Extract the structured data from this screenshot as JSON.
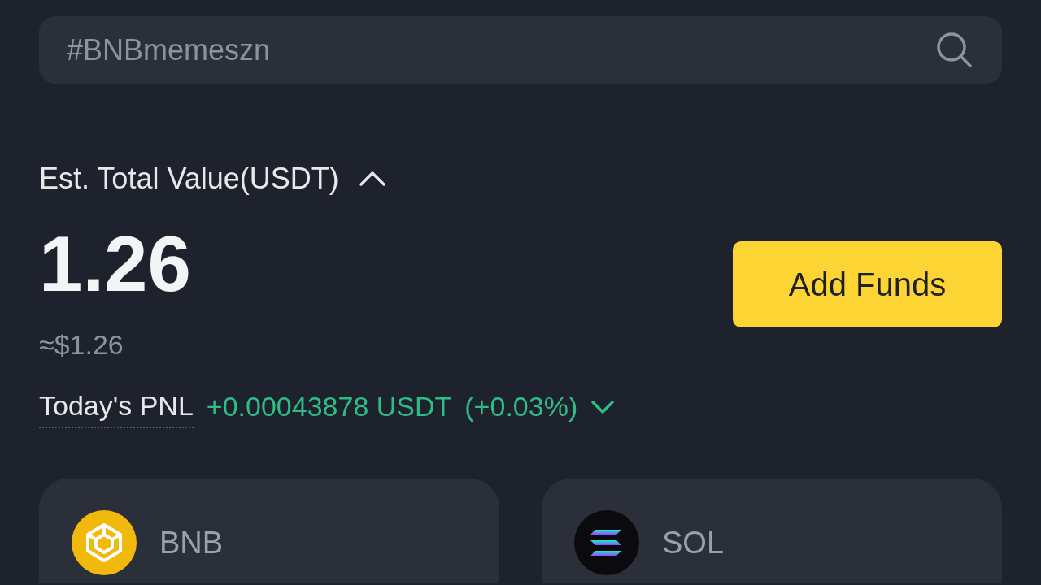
{
  "search": {
    "placeholder": "#BNBmemeszn"
  },
  "balance": {
    "label": "Est. Total Value(USDT)",
    "expanded": true,
    "value": "1.26",
    "fiat": "≈$1.26"
  },
  "pnl": {
    "label": "Today's PNL",
    "value": "+0.00043878 USDT",
    "percent": "(+0.03%)",
    "expanded": false
  },
  "add_funds_button": "Add Funds",
  "assets": [
    {
      "kind": "bnb",
      "symbol": "BNB"
    },
    {
      "kind": "sol",
      "symbol": "SOL"
    }
  ]
}
